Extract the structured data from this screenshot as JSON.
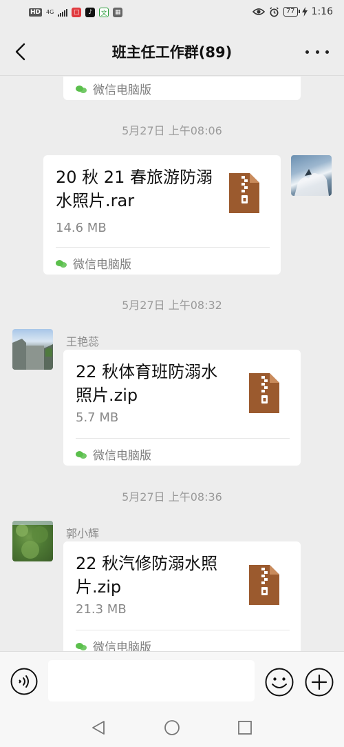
{
  "status_bar": {
    "hd": "HD",
    "network": "4G",
    "battery": "77",
    "time": "1:16"
  },
  "header": {
    "title": "班主任工作群(89)"
  },
  "messages": {
    "top_partial": {
      "source": "微信电脑版"
    },
    "msg1": {
      "timestamp": "5月27日 上午08:06",
      "file_name": "20 秋 21 春旅游防溺水照片.rar",
      "file_size": "14.6 MB",
      "source": "微信电脑版"
    },
    "msg2": {
      "timestamp": "5月27日 上午08:32",
      "sender": "王艳蕊",
      "file_name": "22 秋体育班防溺水照片.zip",
      "file_size": "5.7 MB",
      "source": "微信电脑版"
    },
    "msg3": {
      "timestamp": "5月27日 上午08:36",
      "sender": "郭小辉",
      "file_name": "22 秋汽修防溺水照片.zip",
      "file_size": "21.3 MB",
      "source": "微信电脑版"
    }
  },
  "input_bar": {
    "value": ""
  },
  "colors": {
    "background": "#ededed",
    "bubble": "#ffffff",
    "file_icon": "#9b5a2e",
    "wechat_green": "#5bbf4c"
  },
  "icons": [
    "back-arrow-icon",
    "more-icon",
    "file-archive-icon",
    "wechat-icon",
    "voice-icon",
    "emoji-icon",
    "plus-icon",
    "nav-back-icon",
    "nav-home-icon",
    "nav-recents-icon"
  ]
}
